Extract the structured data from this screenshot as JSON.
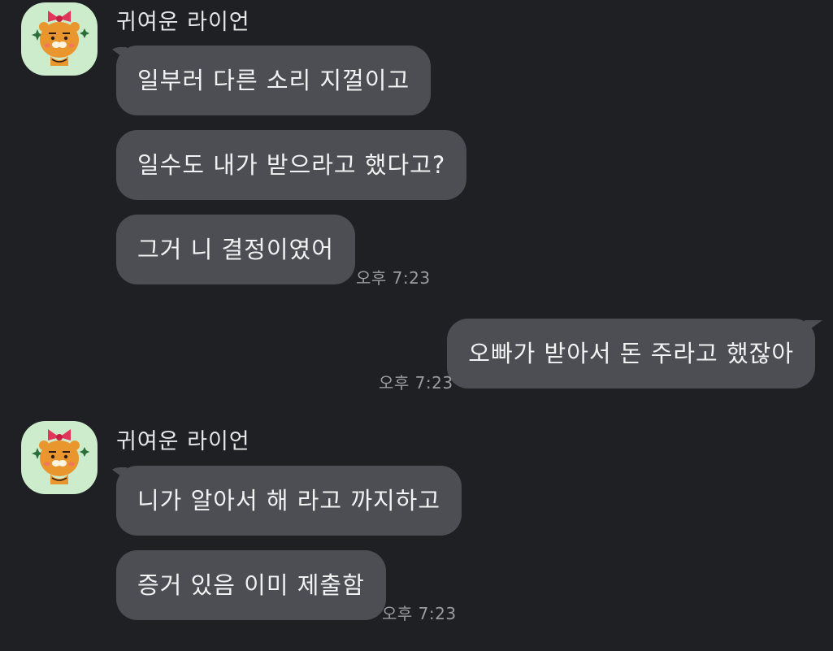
{
  "groups": [
    {
      "sender": "귀여운 라이언",
      "messages": [
        "일부러 다른 소리 지껄이고",
        "일수도 내가 받으라고 했다고?",
        "그거 니 결정이였어"
      ],
      "time": "오후 7:23"
    },
    {
      "sender": "",
      "messages": [
        "오빠가 받아서 돈 주라고 했잖아"
      ],
      "time": "오후 7:23"
    },
    {
      "sender": "귀여운 라이언",
      "messages": [
        "니가 알아서 해 라고 까지하고",
        "증거 있음 이미 제출함"
      ],
      "time": "오후 7:23"
    }
  ],
  "colors": {
    "background": "#1f2024",
    "bubble": "#4c4e53",
    "avatar_bg": "#cdeccb",
    "time_text": "#9b9ca0"
  },
  "icons": {
    "avatar": "ryan-with-ribbon-icon"
  }
}
